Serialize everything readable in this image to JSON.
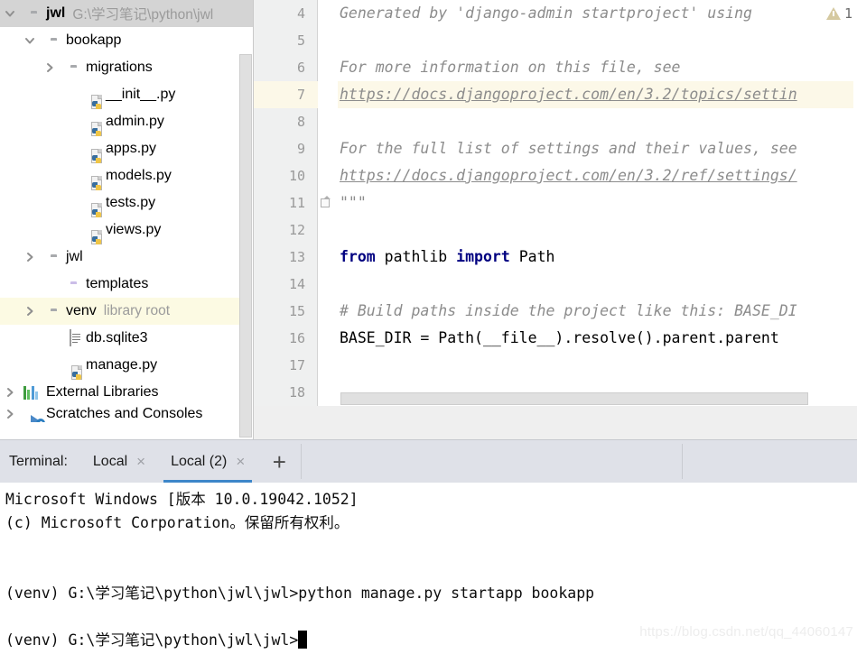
{
  "project_panel": {
    "root": {
      "label": "jwl",
      "path": "G:\\学习笔记\\python\\jwl",
      "icon": "folder-icon",
      "arrow": "chevron-down-icon"
    },
    "items": [
      {
        "label": "bookapp",
        "sub": "",
        "icon": "folder-module-icon",
        "arrow": "chevron-down-icon",
        "indent": 1
      },
      {
        "label": "migrations",
        "sub": "",
        "icon": "folder-module-icon",
        "arrow": "chevron-right-icon",
        "indent": 2
      },
      {
        "label": "__init__.py",
        "sub": "",
        "icon": "python-file-icon",
        "arrow": "",
        "indent": 3
      },
      {
        "label": "admin.py",
        "sub": "",
        "icon": "python-file-icon",
        "arrow": "",
        "indent": 3
      },
      {
        "label": "apps.py",
        "sub": "",
        "icon": "python-file-icon",
        "arrow": "",
        "indent": 3
      },
      {
        "label": "models.py",
        "sub": "",
        "icon": "python-file-icon",
        "arrow": "",
        "indent": 3
      },
      {
        "label": "tests.py",
        "sub": "",
        "icon": "python-file-icon",
        "arrow": "",
        "indent": 3
      },
      {
        "label": "views.py",
        "sub": "",
        "icon": "python-file-icon",
        "arrow": "",
        "indent": 3
      },
      {
        "label": "jwl",
        "sub": "",
        "icon": "folder-module-icon",
        "arrow": "chevron-right-icon",
        "indent": 1
      },
      {
        "label": "templates",
        "sub": "",
        "icon": "folder-purple-icon",
        "arrow": "",
        "indent": 2
      },
      {
        "label": "venv",
        "sub": "library root",
        "icon": "folder-icon",
        "arrow": "chevron-right-icon",
        "indent": 1,
        "selected": true
      },
      {
        "label": "db.sqlite3",
        "sub": "",
        "icon": "db-file-icon",
        "arrow": "",
        "indent": 2
      },
      {
        "label": "manage.py",
        "sub": "",
        "icon": "python-file-icon",
        "arrow": "",
        "indent": 2
      },
      {
        "label": "External Libraries",
        "sub": "",
        "icon": "libraries-icon",
        "arrow": "chevron-right-icon",
        "indent": 0
      },
      {
        "label": "Scratches and Consoles",
        "sub": "",
        "icon": "scratches-icon",
        "arrow": "chevron-right-icon",
        "indent": 0,
        "clipped": true
      }
    ]
  },
  "editor": {
    "warning": {
      "icon": "warning-triangle-icon",
      "count": "1"
    },
    "lines": [
      {
        "no": "4",
        "segments": [
          {
            "t": "comment",
            "s": "Generated by 'django-admin startproject' using"
          }
        ]
      },
      {
        "no": "5",
        "segments": []
      },
      {
        "no": "6",
        "segments": [
          {
            "t": "comment",
            "s": "For more information on this file, see"
          }
        ]
      },
      {
        "no": "7",
        "highlight": true,
        "segments": [
          {
            "t": "link",
            "s": "https://docs.djangoproject.com/en/3.2/topics/settin"
          }
        ]
      },
      {
        "no": "8",
        "segments": []
      },
      {
        "no": "9",
        "segments": [
          {
            "t": "comment",
            "s": "For the full list of settings and their values, see"
          }
        ]
      },
      {
        "no": "10",
        "segments": [
          {
            "t": "link",
            "s": "https://docs.djangoproject.com/en/3.2/ref/settings/"
          }
        ]
      },
      {
        "no": "11",
        "fold": true,
        "segments": [
          {
            "t": "comment",
            "s": "\"\"\""
          }
        ]
      },
      {
        "no": "12",
        "segments": []
      },
      {
        "no": "13",
        "segments": [
          {
            "t": "kw",
            "s": "from"
          },
          {
            "t": "plain",
            "s": " pathlib "
          },
          {
            "t": "kw",
            "s": "import"
          },
          {
            "t": "plain",
            "s": " Path"
          }
        ]
      },
      {
        "no": "14",
        "segments": []
      },
      {
        "no": "15",
        "segments": [
          {
            "t": "comment",
            "s": "# Build paths inside the project like this: BASE_DI"
          }
        ]
      },
      {
        "no": "16",
        "segments": [
          {
            "t": "plain",
            "s": "BASE_DIR = Path(__file__).resolve().parent.parent"
          }
        ]
      },
      {
        "no": "17",
        "segments": []
      },
      {
        "no": "18",
        "segments": []
      }
    ]
  },
  "terminal": {
    "label": "Terminal:",
    "tabs": [
      {
        "title": "Local",
        "close": "×",
        "active": false
      },
      {
        "title": "Local (2)",
        "close": "×",
        "active": true
      }
    ],
    "add_button": "+",
    "output": [
      {
        "text": "Microsoft Windows [版本 10.0.19042.1052]"
      },
      {
        "text": "(c) Microsoft Corporation。保留所有权利。"
      },
      {
        "text": ""
      },
      {
        "text": ""
      },
      {
        "text": "(venv) G:\\学习笔记\\python\\jwl\\jwl>python manage.py startapp bookapp"
      },
      {
        "text": ""
      },
      {
        "text": "(venv) G:\\学习笔记\\python\\jwl\\jwl>",
        "cursor": true
      }
    ],
    "watermark": "https://blog.csdn.net/qq_44060147"
  },
  "colors": {
    "accent": "#3d86c9",
    "selection": "#fcfae3",
    "gutter": "#eff0f0",
    "keyword": "#000080",
    "comment": "#8c8c8c",
    "terminal_tabbar": "#dfe1e8"
  }
}
